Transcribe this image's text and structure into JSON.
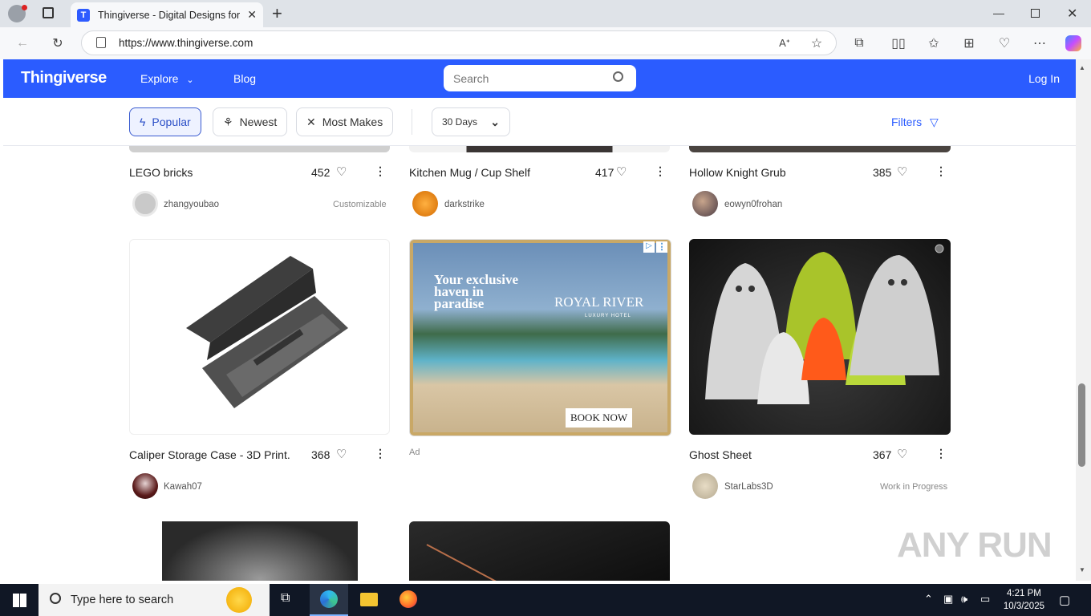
{
  "browser": {
    "tab_title": "Thingiverse - Digital Designs for P",
    "tab_favicon": "T",
    "url": "https://www.thingiverse.com"
  },
  "site": {
    "logo": "Thingiverse",
    "nav_explore": "Explore",
    "nav_blog": "Blog",
    "search_placeholder": "Search",
    "login": "Log In",
    "brand_color": "#2b5cff"
  },
  "filters": {
    "popular": "Popular",
    "newest": "Newest",
    "most_makes": "Most Makes",
    "period": "30 Days",
    "filters_label": "Filters"
  },
  "cards": [
    {
      "title": "LEGO bricks",
      "likes": "452",
      "author": "zhangyoubao",
      "badge": "Customizable"
    },
    {
      "title": "Kitchen Mug / Cup Shelf",
      "likes": "417",
      "author": "darkstrike",
      "badge": ""
    },
    {
      "title": "Hollow Knight Grub",
      "likes": "385",
      "author": "eowyn0frohan",
      "badge": ""
    },
    {
      "title": "Caliper Storage Case - 3D Print...",
      "likes": "368",
      "author": "Kawah07",
      "badge": ""
    },
    {
      "title": "Ghost Sheet",
      "likes": "367",
      "author": "StarLabs3D",
      "badge": "Work in Progress"
    }
  ],
  "ad": {
    "headline_line1": "Your exclusive",
    "headline_line2": "haven in",
    "headline_line3": "paradise",
    "brand": "ROYAL RIVER",
    "brand_sub": "LUXURY HOTEL",
    "cta": "BOOK NOW",
    "label": "Ad"
  },
  "taskbar": {
    "search_text": "Type here to search",
    "time": "4:21 PM",
    "date": "10/3/2025"
  },
  "watermark": "ANY RUN"
}
